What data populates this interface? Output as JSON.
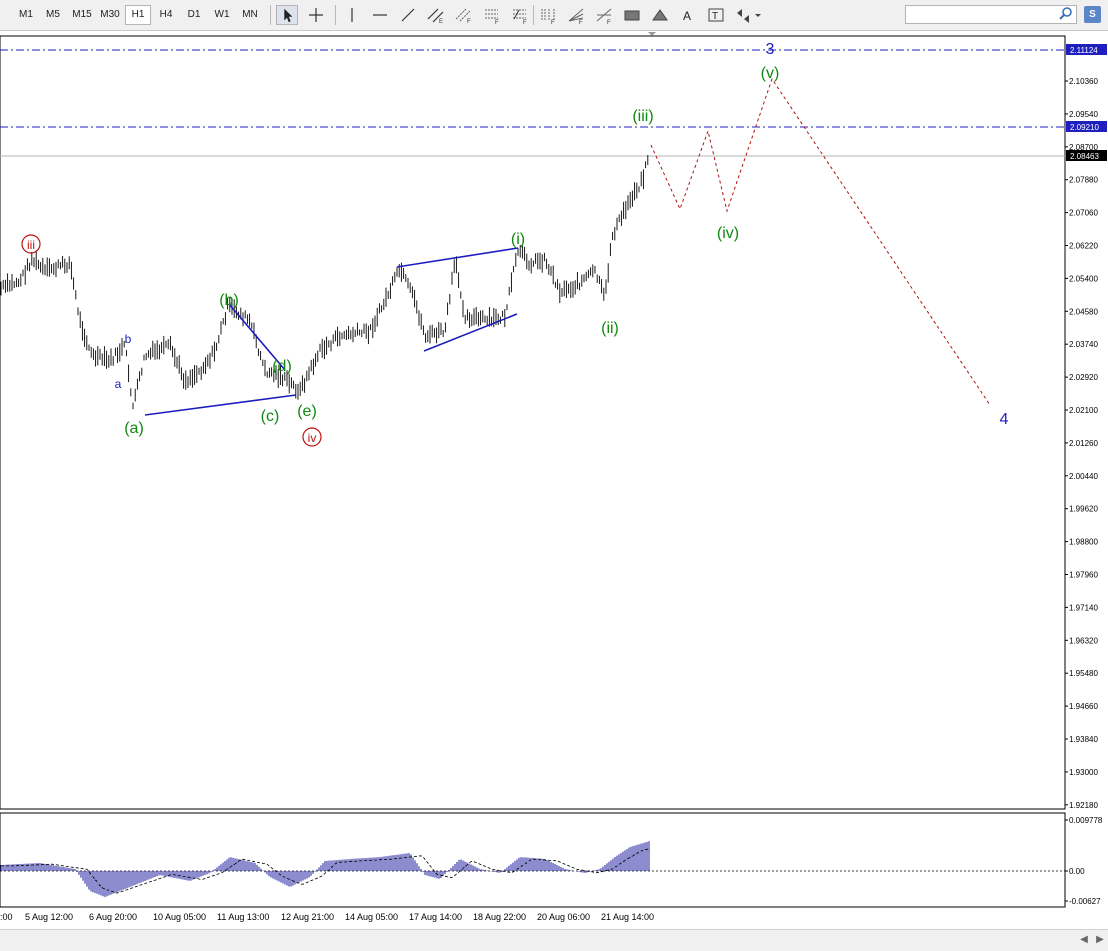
{
  "toolbar": {
    "timeframes": [
      "M1",
      "M5",
      "M15",
      "M30",
      "H1",
      "H4",
      "D1",
      "W1",
      "MN"
    ],
    "active_timeframe": "H1",
    "search_placeholder": "",
    "signal_button": "S"
  },
  "chart": {
    "price_labels": [
      "2.10360",
      "2.09540",
      "2.08700",
      "2.07880",
      "2.07060",
      "2.06220",
      "2.05400",
      "2.04580",
      "2.03740",
      "2.02920",
      "2.02100",
      "2.01260",
      "2.00440",
      "1.99620",
      "1.98800",
      "1.97960",
      "1.97140",
      "1.96320",
      "1.95480",
      "1.94660",
      "1.93840",
      "1.93000",
      "1.92180"
    ],
    "hline_prices": {
      "level_upper": "2.11124",
      "level_lower": "2.09210",
      "current": "2.08463"
    },
    "colors": {
      "hline": "#1f1fbf",
      "current_bg": "#000000",
      "bars": "#000000",
      "wave_green": "#118811",
      "wave_blue": "#1d1dbf",
      "wave_red": "#c01010",
      "projection": "#b01010"
    },
    "wave_labels": {
      "w3": "3",
      "w4": "4",
      "wv": "(v)",
      "wiii": "(iii)",
      "wiv": "(iv)",
      "wi": "(i)",
      "wii": "(ii)",
      "wa": "(a)",
      "wb": "(b)",
      "wc": "(c)",
      "wd": "(d)",
      "we": "(e)",
      "small_a": "a",
      "small_b": "b",
      "roman_iii": "iii",
      "roman_iv": "iv"
    },
    "time_labels": [
      "5 Aug 12:00",
      "6 Aug 20:00",
      "10 Aug 05:00",
      "11 Aug 13:00",
      "12 Aug 21:00",
      "14 Aug 05:00",
      "17 Aug 14:00",
      "18 Aug 22:00",
      "20 Aug 06:00",
      "21 Aug 14:00"
    ],
    "time_label_left_fragment": ":00"
  },
  "indicator": {
    "levels": [
      "0.009778",
      "0.00",
      "-0.00627"
    ]
  }
}
